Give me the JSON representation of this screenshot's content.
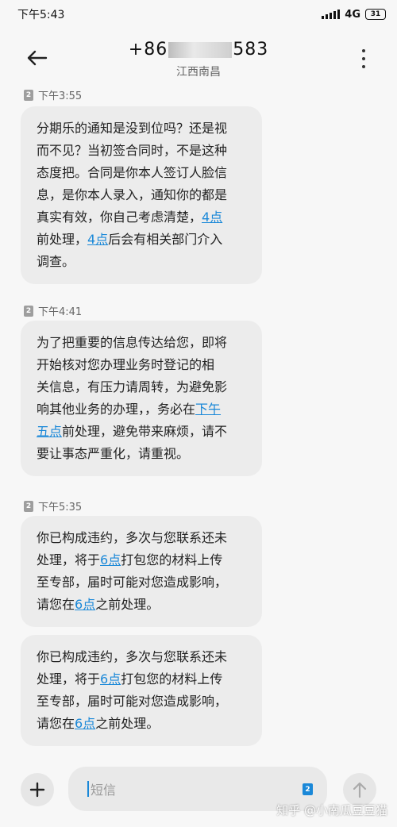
{
  "status_bar": {
    "time": "下午5:43",
    "network": "4G",
    "network_sup": "ill",
    "battery": "31"
  },
  "header": {
    "number_prefix": "+86",
    "number_suffix": "583",
    "location": "江西南昌"
  },
  "messages": [
    {
      "sim": "2",
      "time": "下午3:55",
      "lines": [
        {
          "parts": [
            {
              "t": "分期乐的通知是没到位吗？还是视"
            }
          ]
        },
        {
          "parts": [
            {
              "t": "而不见？当初签合同时，不是这种"
            }
          ]
        },
        {
          "parts": [
            {
              "t": "态度把。合同是你本人签订人脸信"
            }
          ]
        },
        {
          "parts": [
            {
              "t": "息，是你本人录入，通知你的都是"
            }
          ]
        },
        {
          "parts": [
            {
              "t": "真实有效，你自己考虑清楚，"
            },
            {
              "t": "4点",
              "link": true
            }
          ]
        },
        {
          "parts": [
            {
              "t": "前处理，"
            },
            {
              "t": "4点",
              "link": true
            },
            {
              "t": "后会有相关部门介入"
            }
          ]
        },
        {
          "parts": [
            {
              "t": "调查。"
            }
          ]
        }
      ]
    },
    {
      "sim": "2",
      "time": "下午4:41",
      "lines": [
        {
          "parts": [
            {
              "t": "为了把重要的信息传达给您，即将"
            }
          ]
        },
        {
          "parts": [
            {
              "t": "开始核对您办理业务时登记的相"
            }
          ]
        },
        {
          "parts": [
            {
              "t": "关信息，有压力请周转，为避免影"
            }
          ]
        },
        {
          "parts": [
            {
              "t": "响其他业务的办理，，务必在"
            },
            {
              "t": "下午",
              "link": true
            }
          ]
        },
        {
          "parts": [
            {
              "t": "五点",
              "link": true
            },
            {
              "t": "前处理，避免带来麻烦，请不"
            }
          ]
        },
        {
          "parts": [
            {
              "t": "要让事态严重化，请重视。"
            }
          ]
        }
      ]
    },
    {
      "sim": "2",
      "time": "下午5:35",
      "lines": [
        {
          "parts": [
            {
              "t": "你已构成违约，多次与您联系还未"
            }
          ]
        },
        {
          "parts": [
            {
              "t": "处理，将于"
            },
            {
              "t": "6点",
              "link": true
            },
            {
              "t": "打包您的材料上传"
            }
          ]
        },
        {
          "parts": [
            {
              "t": "至专部，届时可能对您造成影响，"
            }
          ]
        },
        {
          "parts": [
            {
              "t": "请您在"
            },
            {
              "t": "6点",
              "link": true
            },
            {
              "t": "之前处理。"
            }
          ]
        }
      ]
    },
    {
      "sim": "",
      "time": "",
      "lines": [
        {
          "parts": [
            {
              "t": "你已构成违约，多次与您联系还未"
            }
          ]
        },
        {
          "parts": [
            {
              "t": "处理，将于"
            },
            {
              "t": "6点",
              "link": true
            },
            {
              "t": "打包您的材料上传"
            }
          ]
        },
        {
          "parts": [
            {
              "t": "至专部，届时可能对您造成影响，"
            }
          ]
        },
        {
          "parts": [
            {
              "t": "请您在"
            },
            {
              "t": "6点",
              "link": true
            },
            {
              "t": "之前处理。"
            }
          ]
        }
      ]
    }
  ],
  "composer": {
    "add_icon": "plus-icon",
    "placeholder": "短信",
    "sim_badge": "2",
    "send_icon": "arrow-up-icon"
  },
  "watermark": "知乎 @小南瓜豆豆猫",
  "colors": {
    "link": "#1a88d8",
    "bubble": "#ececec",
    "background": "#f7f7f7"
  }
}
